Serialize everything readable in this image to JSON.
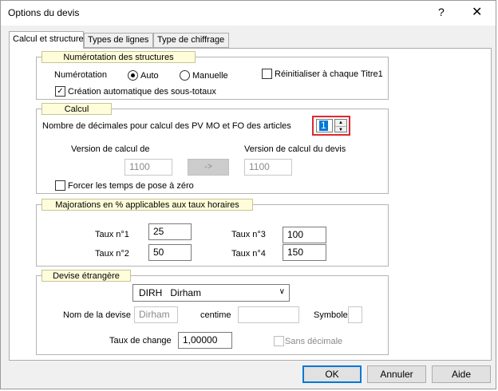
{
  "window": {
    "title": "Options du devis",
    "help": "?",
    "close": "✕"
  },
  "tabs": [
    "Calcul et structure",
    "Types de lignes",
    "Type de chiffrage"
  ],
  "structures": {
    "legend": "Numérotation des structures",
    "numerotation_label": "Numérotation",
    "auto_label": "Auto",
    "manuelle_label": "Manuelle",
    "selected": "Auto",
    "reinit_label": "Réinitialiser à chaque Titre1",
    "reinit_checked": false,
    "creation_label": "Création automatique des sous-totaux",
    "creation_checked": true
  },
  "calcul": {
    "legend": "Calcul",
    "decimales_label": "Nombre de décimales pour calcul des PV MO et FO des articles",
    "decimales_value": "1",
    "version_calcul_label": "Version de calcul de",
    "version_calcul_value": "1100",
    "arrow_label": "->",
    "version_devis_label": "Version de calcul du devis",
    "version_devis_value": "1100",
    "forcer_label": "Forcer les temps de pose à zéro",
    "forcer_checked": false
  },
  "majorations": {
    "legend": "Majorations en % applicables aux taux horaires",
    "taux1_label": "Taux n°1",
    "taux1_value": "25",
    "taux2_label": "Taux n°2",
    "taux2_value": "50",
    "taux3_label": "Taux n°3",
    "taux3_value": "100",
    "taux4_label": "Taux n°4",
    "taux4_value": "150"
  },
  "devise": {
    "legend": "Devise étrangère",
    "selected_code": "DIRH",
    "selected_name": "Dirham",
    "nom_label": "Nom de la devise",
    "nom_value": "Dirham",
    "centime_label": "centime",
    "centime_value": "",
    "symbole_label": "Symbole",
    "symbole_value": "",
    "taux_label": "Taux de change",
    "taux_value": "1,00000",
    "sans_decimale_label": "Sans décimale",
    "sans_decimale_checked": false
  },
  "buttons": {
    "ok": "OK",
    "annuler": "Annuler",
    "aide": "Aide"
  },
  "colors": {
    "legend_bg": "#fffdd9",
    "highlight": "#e0282f",
    "selection": "#0078d7"
  }
}
